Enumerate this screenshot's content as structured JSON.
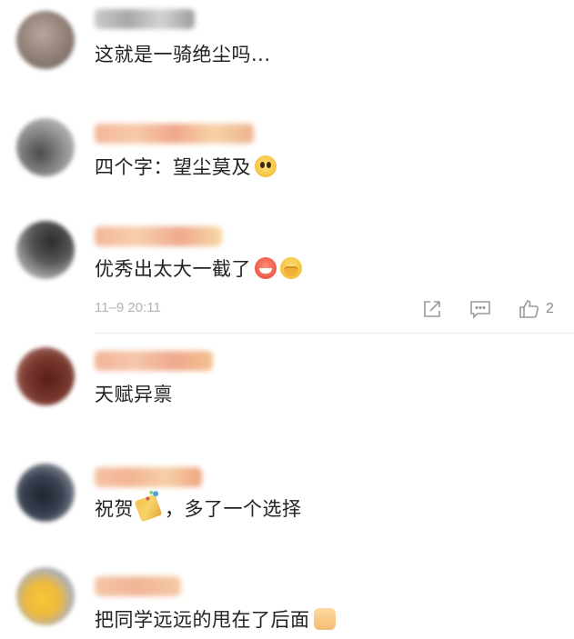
{
  "comments": [
    {
      "text": "这就是一骑绝尘吗...",
      "emojis": []
    },
    {
      "text": "四个字：望尘莫及",
      "emojis": [
        "fear-face-emoji"
      ]
    },
    {
      "text": "优秀出太大一截了",
      "emojis": [
        "grin-emoji",
        "cover-mouth-emoji"
      ],
      "timestamp": "11–9 20:11",
      "likes": "2"
    },
    {
      "text": "天赋异禀",
      "emojis": []
    },
    {
      "text_before": "祝贺",
      "text_after": "，多了一个选择",
      "emojis": [
        "party-popper-emoji"
      ]
    },
    {
      "text": "把同学远远的甩在了后面",
      "emojis": [
        "thumbs-up-emoji"
      ]
    }
  ],
  "icons": {
    "share": "share-icon",
    "comment": "comment-icon",
    "like": "thumbs-up-icon"
  },
  "colors": {
    "text": "#222222",
    "meta": "#b3b3b3",
    "divider": "#ececec"
  }
}
